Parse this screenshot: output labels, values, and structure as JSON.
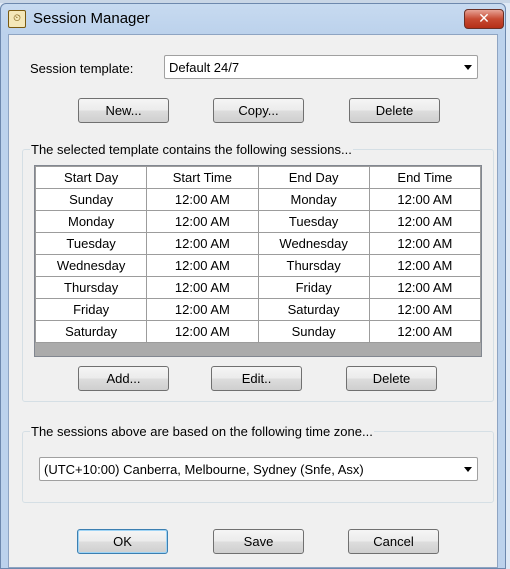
{
  "window": {
    "title": "Session Manager",
    "close_glyph": "✕",
    "icon": "clock-app-icon"
  },
  "template": {
    "label": "Session template:",
    "value": "Default 24/7",
    "buttons": {
      "new": "New...",
      "copy": "Copy...",
      "delete": "Delete"
    }
  },
  "sessions": {
    "group_title": "The selected template contains the following sessions...",
    "columns": [
      "Start Day",
      "Start Time",
      "End Day",
      "End Time"
    ],
    "rows": [
      [
        "Sunday",
        "12:00 AM",
        "Monday",
        "12:00 AM"
      ],
      [
        "Monday",
        "12:00 AM",
        "Tuesday",
        "12:00 AM"
      ],
      [
        "Tuesday",
        "12:00 AM",
        "Wednesday",
        "12:00 AM"
      ],
      [
        "Wednesday",
        "12:00 AM",
        "Thursday",
        "12:00 AM"
      ],
      [
        "Thursday",
        "12:00 AM",
        "Friday",
        "12:00 AM"
      ],
      [
        "Friday",
        "12:00 AM",
        "Saturday",
        "12:00 AM"
      ],
      [
        "Saturday",
        "12:00 AM",
        "Sunday",
        "12:00 AM"
      ]
    ],
    "buttons": {
      "add": "Add...",
      "edit": "Edit..",
      "delete": "Delete"
    }
  },
  "timezone": {
    "group_title": "The sessions above are based on the following time zone...",
    "value": "(UTC+10:00) Canberra, Melbourne, Sydney (Snfe, Asx)"
  },
  "footer": {
    "ok": "OK",
    "save": "Save",
    "cancel": "Cancel"
  }
}
